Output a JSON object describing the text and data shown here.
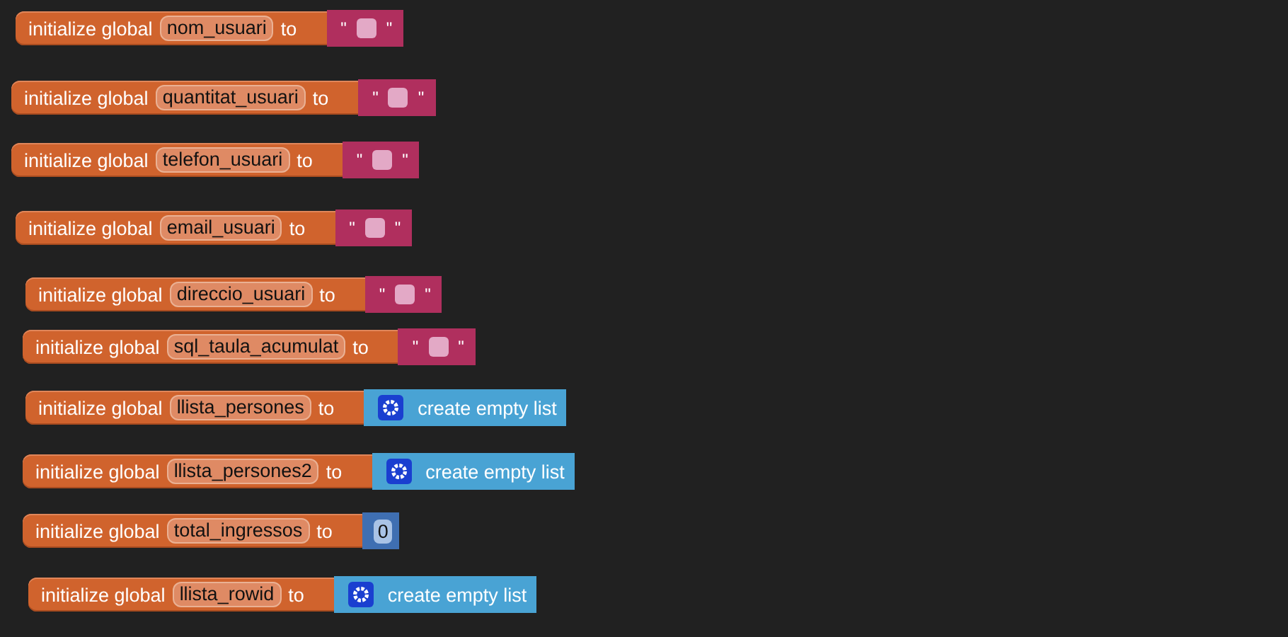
{
  "blocks": [
    {
      "label": "initialize global",
      "name": "nom_usuari",
      "to": "to",
      "value": {
        "kind": "text",
        "open": "\"",
        "close": "\""
      }
    },
    {
      "label": "initialize global",
      "name": "quantitat_usuari",
      "to": "to",
      "value": {
        "kind": "text",
        "open": "\"",
        "close": "\""
      }
    },
    {
      "label": "initialize global",
      "name": "telefon_usuari",
      "to": "to",
      "value": {
        "kind": "text",
        "open": "\"",
        "close": "\""
      }
    },
    {
      "label": "initialize global",
      "name": "email_usuari",
      "to": "to",
      "value": {
        "kind": "text",
        "open": "\"",
        "close": "\""
      }
    },
    {
      "label": "initialize global",
      "name": "direccio_usuari",
      "to": "to",
      "value": {
        "kind": "text",
        "open": "\"",
        "close": "\""
      }
    },
    {
      "label": "initialize global",
      "name": "sql_taula_acumulat",
      "to": "to",
      "value": {
        "kind": "text",
        "open": "\"",
        "close": "\""
      }
    },
    {
      "label": "initialize global",
      "name": "llista_persones",
      "to": "to",
      "value": {
        "kind": "list",
        "label": "create empty list"
      }
    },
    {
      "label": "initialize global",
      "name": "llista_persones2",
      "to": "to",
      "value": {
        "kind": "list",
        "label": "create empty list"
      }
    },
    {
      "label": "initialize global",
      "name": "total_ingressos",
      "to": "to",
      "value": {
        "kind": "number",
        "text": "0"
      }
    },
    {
      "label": "initialize global",
      "name": "llista_rowid",
      "to": "to",
      "value": {
        "kind": "list",
        "label": "create empty list"
      }
    }
  ]
}
